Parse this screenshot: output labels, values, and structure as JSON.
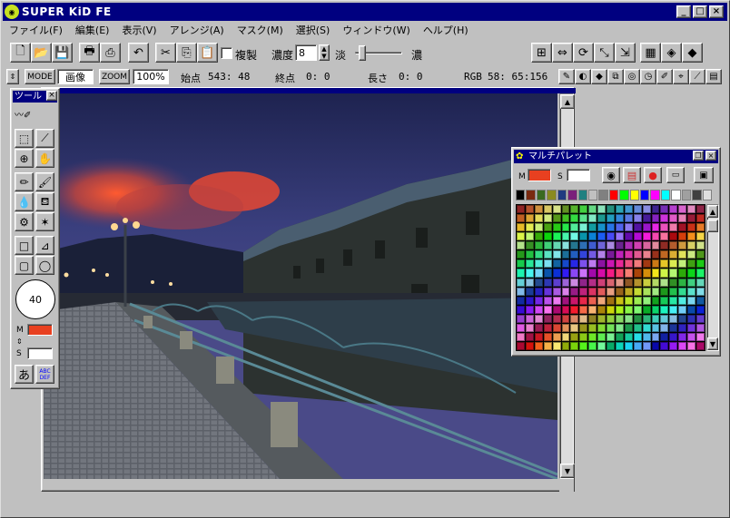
{
  "window": {
    "title": "SUPER KiD FE",
    "icon": "app-logo-icon"
  },
  "menu": [
    "ファイル(F)",
    "編集(E)",
    "表示(V)",
    "アレンジ(A)",
    "マスク(M)",
    "選択(S)",
    "ウィンドウ(W)",
    "ヘルプ(H)"
  ],
  "toolbar": {
    "duplicate_label": "複製",
    "density_label": "濃度",
    "density_value": "8",
    "light_label": "淡",
    "dark_label": "濃"
  },
  "status": {
    "mode_label": "MODE",
    "mode_value": "画像",
    "zoom_label": "ZOOM",
    "zoom_value": "100%",
    "start_label": "始点",
    "start_value": "543:   48",
    "end_label": "終点",
    "end_value": "0:    0",
    "length_label": "長さ",
    "length_value": "0:    0",
    "rgb_label": "RGB",
    "rgb_value": "58: 65:156"
  },
  "toolbox": {
    "title": "ツール",
    "brush_size": "40",
    "main_label": "M",
    "sub_label": "S",
    "text_tool": "あ",
    "text_tool2": "ABC DEF"
  },
  "palette": {
    "title": "マルチパレット",
    "main_label": "M",
    "sub_label": "S"
  },
  "colors": {
    "title_bar": "#000080",
    "main_color": "#e84020",
    "sub_color": "#ffffff"
  }
}
